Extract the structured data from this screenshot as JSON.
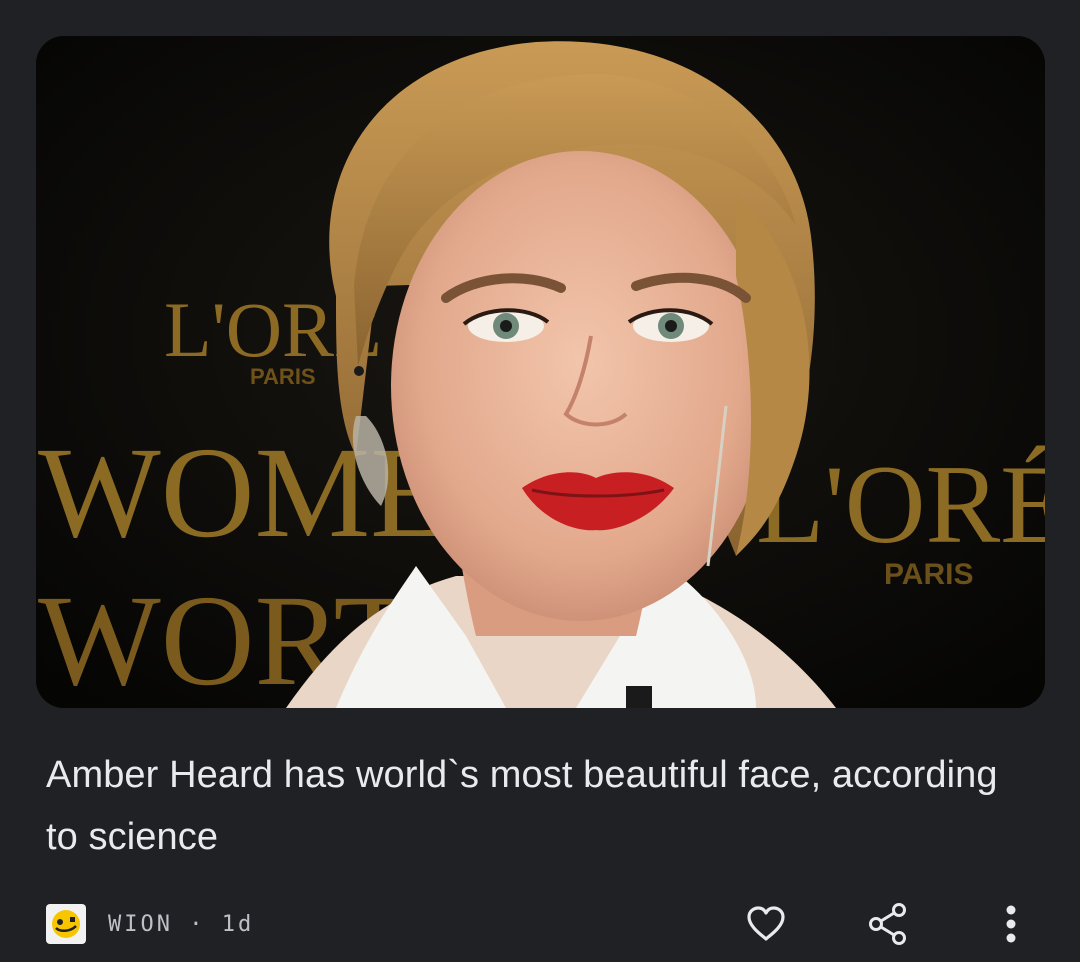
{
  "article": {
    "headline": "Amber Heard has world`s most beautiful face, according to science",
    "source_name": "WION",
    "separator": "·",
    "age": "1d",
    "image": {
      "backdrop_text_1": "L'ORÉ",
      "backdrop_text_2": "PARIS",
      "backdrop_text_3": "WOME",
      "backdrop_text_4": "WORT",
      "backdrop_text_5": "L'ORÉ",
      "backdrop_text_6": "PARIS"
    }
  },
  "actions": {
    "like_icon": "heart-icon",
    "share_icon": "share-icon",
    "more_icon": "more-vert-icon"
  },
  "colors": {
    "background": "#202124",
    "text_primary": "#e8eaed",
    "text_secondary": "#bdc1c6",
    "logo_accent": "#f7c600"
  }
}
